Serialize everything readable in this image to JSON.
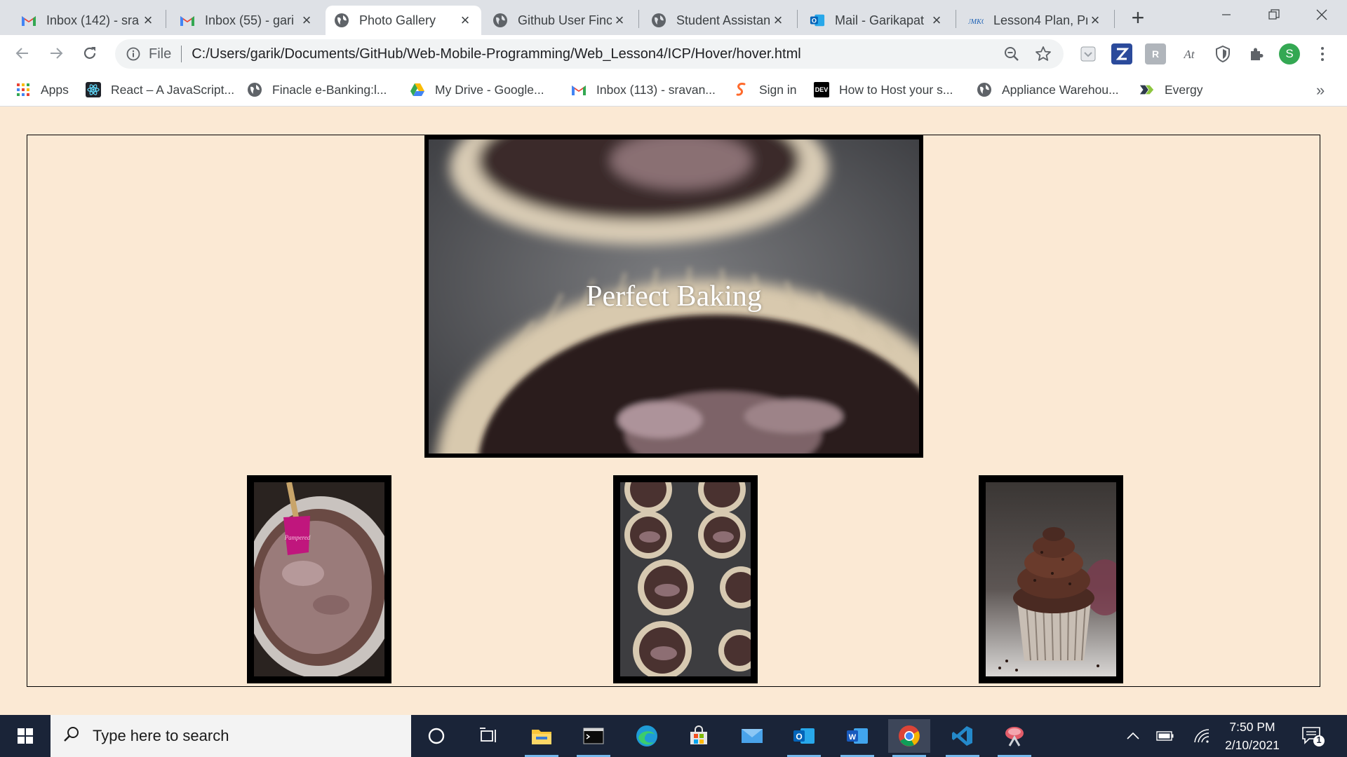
{
  "browser": {
    "tabs": [
      {
        "title": "Inbox (142) - sra",
        "icon": "gmail-icon",
        "active": false
      },
      {
        "title": "Inbox (55) - gari",
        "icon": "gmail-icon",
        "active": false
      },
      {
        "title": "Photo Gallery",
        "icon": "globe-icon",
        "active": true
      },
      {
        "title": "Github User Finc",
        "icon": "globe-icon",
        "active": false
      },
      {
        "title": "Student Assistan",
        "icon": "globe-icon",
        "active": false
      },
      {
        "title": "Mail - Garikapat",
        "icon": "outlook-icon",
        "active": false
      },
      {
        "title": "Lesson4 Plan, Pr",
        "icon": "umkc-icon",
        "active": false
      }
    ],
    "new_tab_label": "+",
    "address": {
      "scheme": "File",
      "url": "C:/Users/garik/Documents/GitHub/Web-Mobile-Programming/Web_Lesson4/ICP/Hover/hover.html"
    },
    "profile_initial": "S",
    "bookmarks": [
      {
        "label": "Apps",
        "icon": "apps-grid-icon"
      },
      {
        "label": "React – A JavaScript...",
        "icon": "react-icon"
      },
      {
        "label": "Finacle e-Banking:l...",
        "icon": "globe-icon"
      },
      {
        "label": "My Drive - Google...",
        "icon": "google-drive-icon"
      },
      {
        "label": "Inbox (113) - sravan...",
        "icon": "gmail-icon"
      },
      {
        "label": "Sign in",
        "icon": "sign-in-icon"
      },
      {
        "label": "How to Host your s...",
        "icon": "dev-icon"
      },
      {
        "label": "Appliance Warehou...",
        "icon": "globe-icon"
      },
      {
        "label": "Evergy",
        "icon": "evergy-icon"
      }
    ],
    "bookmarks_more": "»",
    "dev_badge": "DEV"
  },
  "page": {
    "hero_caption": "Perfect Baking",
    "thumbnails": [
      {
        "name": "batter-bowl",
        "alt": "chocolate batter in bowl"
      },
      {
        "name": "muffin-tin",
        "alt": "batter in cupcake liners"
      },
      {
        "name": "frosted-cupcake",
        "alt": "chocolate frosted cupcake"
      }
    ]
  },
  "taskbar": {
    "search_placeholder": "Type here to search",
    "time": "7:50 PM",
    "date": "2/10/2021",
    "notification_count": "1"
  },
  "colors": {
    "page_background": "#fbe9d4",
    "taskbar": "#1a2438",
    "tab_strip": "#dee1e6"
  }
}
